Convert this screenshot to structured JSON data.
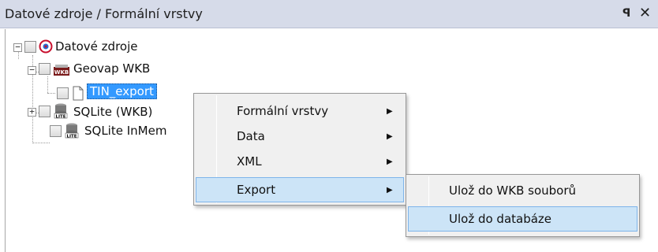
{
  "panel": {
    "title": "Datové zdroje / Formální vrstvy",
    "pin_glyph": "ꟼ",
    "close_glyph": "✕"
  },
  "tree": {
    "root": {
      "label": "Datové zdroje",
      "icon": "datasource-root-icon"
    },
    "children": [
      {
        "label": "Geovap WKB",
        "icon": "wkb-database-icon",
        "children": [
          {
            "label": "TIN_export",
            "icon": "document-icon",
            "selected": true
          }
        ]
      },
      {
        "label": "SQLite (WKB)",
        "icon": "sqlite-database-icon"
      },
      {
        "label": "SQLite InMem",
        "icon": "sqlite-database-icon"
      }
    ]
  },
  "context_menu": {
    "items": [
      {
        "label": "Formální vrstvy",
        "has_submenu": true
      },
      {
        "label": "Data",
        "has_submenu": true
      },
      {
        "label": "XML",
        "has_submenu": true
      },
      {
        "label": "Export",
        "has_submenu": true,
        "highlighted": true
      }
    ]
  },
  "submenu": {
    "items": [
      {
        "label": "Ulož do WKB souborů"
      },
      {
        "label": "Ulož do databáze",
        "highlighted": true
      }
    ]
  },
  "colors": {
    "titlebar": "#d6dbe9",
    "selection": "#3399ff",
    "menu_highlight": "#cce4f7",
    "menu_highlight_border": "#7eb4ea"
  }
}
